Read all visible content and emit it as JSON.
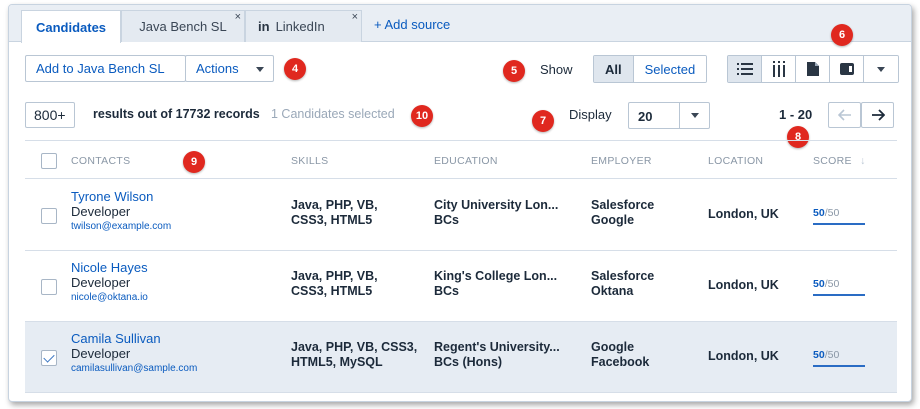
{
  "tabs": [
    {
      "label": "Candidates"
    },
    {
      "label": "Java Bench SL",
      "close": "×"
    },
    {
      "label": "LinkedIn",
      "icon_text": "in",
      "close": "×"
    }
  ],
  "add_source": "+ Add source",
  "toolbar": {
    "add_to_label": "Add to Java Bench SL",
    "actions_label": "Actions",
    "show_label": "Show",
    "show_options": [
      "All",
      "Selected"
    ],
    "view_icons": [
      "list-view-icon",
      "column-view-icon",
      "document-view-icon",
      "card-view-icon",
      "chevron-down-icon"
    ]
  },
  "results": {
    "count": "800+",
    "summary": "results out of 17732 records",
    "selected": "1 Candidates selected",
    "display_label": "Display",
    "display_value": "20",
    "range": "1 - 20"
  },
  "badges": [
    "4",
    "5",
    "6",
    "7",
    "8",
    "9",
    "10"
  ],
  "table": {
    "headers": [
      "CONTACTS",
      "SKILLS",
      "EDUCATION",
      "EMPLOYER",
      "LOCATION",
      "SCORE"
    ],
    "sort_icon": "↓",
    "rows": [
      {
        "name": "Tyrone Wilson",
        "role": "Developer",
        "email": "twilson@example.com",
        "skills_1": "Java, PHP, VB,",
        "skills_2": "CSS3, HTML5",
        "edu_1": "City University Lon...",
        "edu_2": "BCs",
        "emp_1": "Salesforce",
        "emp_2": "Google",
        "location": "London, UK",
        "score": "50",
        "score_max": "/50",
        "score_fraction": 1.0,
        "checked": false
      },
      {
        "name": "Nicole Hayes",
        "role": "Developer",
        "email": "nicole@oktana.io",
        "skills_1": "Java, PHP, VB,",
        "skills_2": "CSS3, HTML5",
        "edu_1": "King's College Lon...",
        "edu_2": "BCs",
        "emp_1": "Salesforce",
        "emp_2": "Oktana",
        "location": "London, UK",
        "score": "50",
        "score_max": "/50",
        "score_fraction": 1.0,
        "checked": false
      },
      {
        "name": "Camila Sullivan",
        "role": "Developer",
        "email": "camilasullivan@sample.com",
        "skills_1": "Java, PHP, VB, CSS3,",
        "skills_2": "HTML5, MySQL",
        "edu_1": "Regent's University...",
        "edu_2": "BCs (Hons)",
        "emp_1": "Google",
        "emp_2": "Facebook",
        "location": "London, UK",
        "score": "50",
        "score_max": "/50",
        "score_fraction": 1.0,
        "checked": true
      }
    ]
  },
  "colors": {
    "accent": "#0a5bbf",
    "badge": "#e0281f",
    "selected_row": "#e6ecf3"
  }
}
